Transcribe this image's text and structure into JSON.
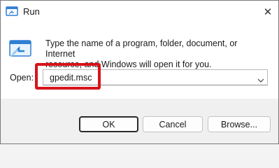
{
  "window": {
    "title": "Run",
    "close_glyph": "✕"
  },
  "icons": {
    "title_icon": "run-app-icon",
    "main_icon": "run-app-icon",
    "close_icon": "close-icon",
    "dropdown_icon": "chevron-down-icon"
  },
  "description": {
    "line1": "Type the name of a program, folder, document, or Internet",
    "line2": "resource, and Windows will open it for you."
  },
  "open_field": {
    "label": "Open:",
    "value": "gpedit.msc"
  },
  "buttons": {
    "ok": "OK",
    "cancel": "Cancel",
    "browse": "Browse..."
  },
  "colors": {
    "highlight": "#d7141a",
    "icon_blue": "#2f7fd3",
    "icon_light": "#9fd0f5"
  }
}
